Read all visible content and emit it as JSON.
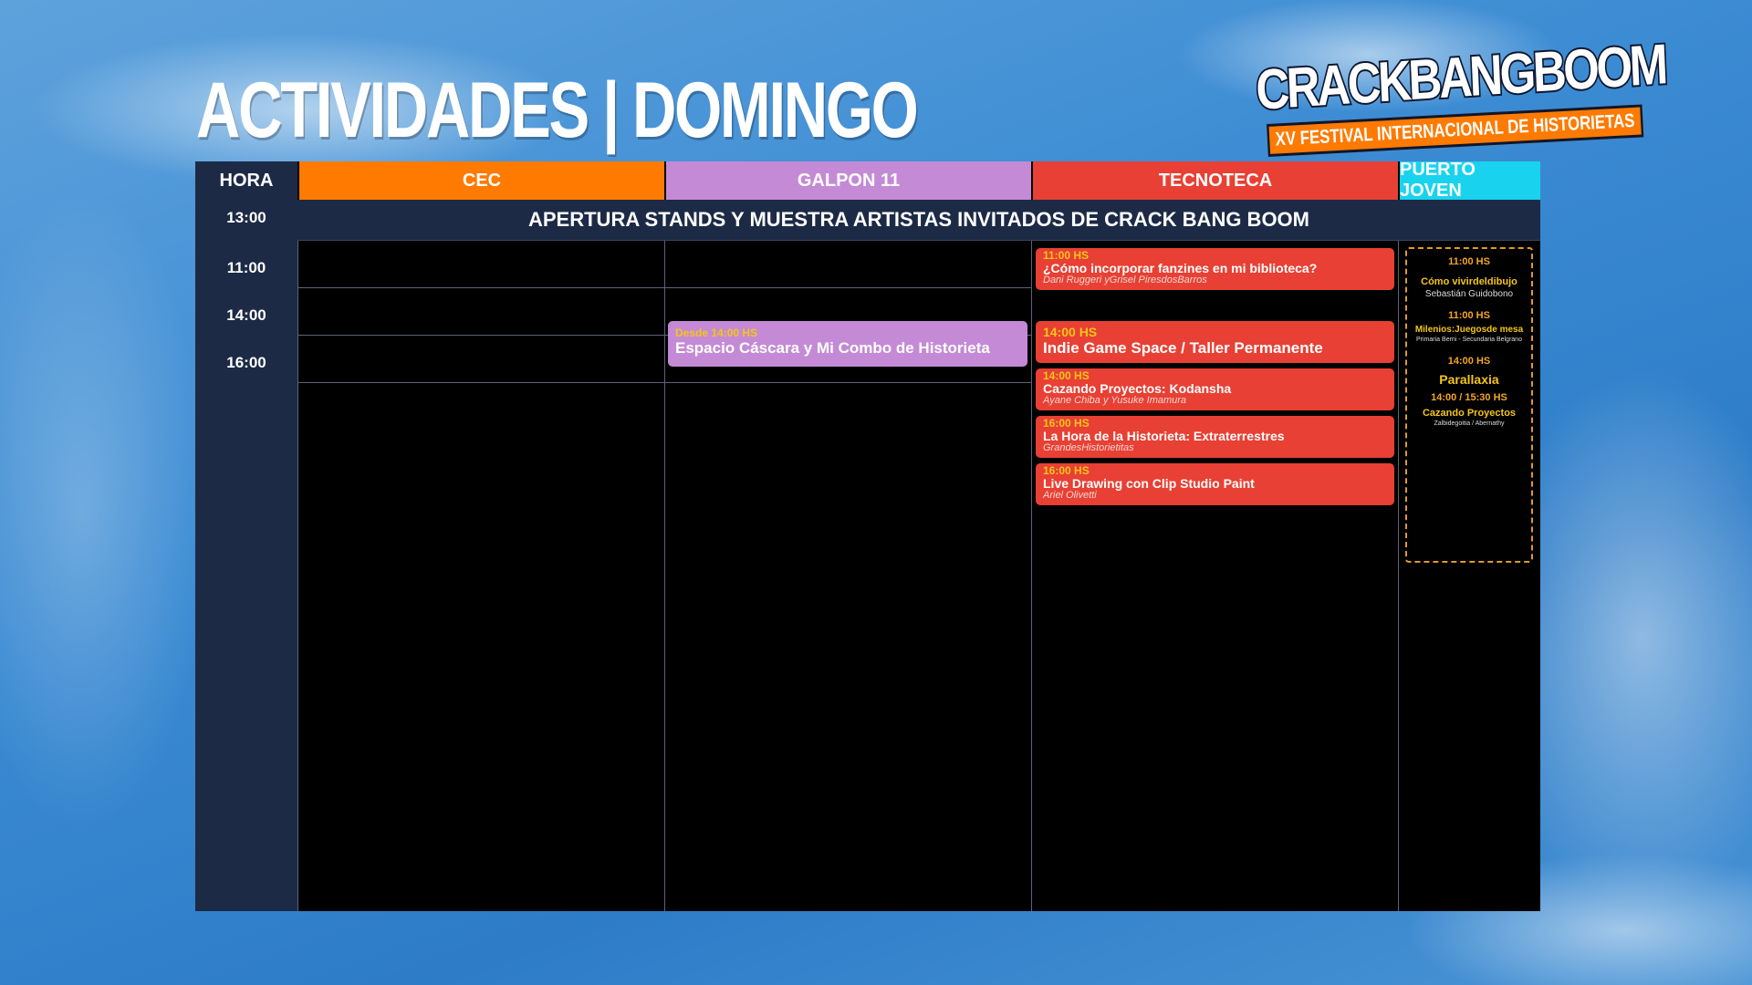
{
  "title": "ACTIVIDADES | DOMINGO",
  "logo": {
    "main": "CRACKBANGBOOM",
    "sub": "XV FESTIVAL INTERNACIONAL DE HISTORIETAS"
  },
  "columns": [
    {
      "label": "HORA",
      "color": "#1c2a45"
    },
    {
      "label": "CEC",
      "color": "#ff7a00"
    },
    {
      "label": "GALPON 11",
      "color": "#c48ad6"
    },
    {
      "label": "TECNOTECA",
      "color": "#e84034"
    },
    {
      "label": "PUERTO JOVEN",
      "color": "#19d3ee"
    }
  ],
  "banner": {
    "time": "13:00",
    "text": "APERTURA STANDS Y MUESTRA ARTISTAS INVITADOS DE CRACK BANG BOOM"
  },
  "times": [
    "11:00",
    "14:00",
    "16:00"
  ],
  "galpon": [
    {
      "time": "Desde 14:00 HS",
      "name": "Espacio Cáscara y Mi Combo de Historieta"
    }
  ],
  "tecnoteca": [
    {
      "time": "11:00 HS",
      "name": "¿Cómo incorporar fanzines en mi biblioteca?",
      "sub": "Dani Ruggeri yGrisel PiresdosBarros"
    },
    {
      "time": "14:00 HS",
      "name": "Indie Game Space / Taller Permanente",
      "sub": ""
    },
    {
      "time": "14:00 HS",
      "name": "Cazando Proyectos: Kodansha",
      "sub": "Ayane Chiba y Yusuke Imamura"
    },
    {
      "time": "16:00 HS",
      "name": "La Hora de la Historieta: Extraterrestres",
      "sub": "GrandesHistorietitas"
    },
    {
      "time": "16:00 HS",
      "name": "Live Drawing con Clip Studio Paint",
      "sub": "Ariel Olivetti"
    }
  ],
  "puerto_joven": [
    {
      "time": "11:00 HS",
      "name": "Cómo vivirdeldibujo",
      "sub": "Sebastián Guidobono"
    },
    {
      "time": "11:00 HS",
      "name": "Milenios:Juegosde mesa",
      "sub": "Primaria Berni - Secundaria Belgrano"
    },
    {
      "time": "14:00 HS",
      "name": "Parallaxia",
      "sub": ""
    },
    {
      "time": "14:00 / 15:30 HS",
      "name": "Cazando Proyectos",
      "sub": "Zalbidegoitia / Abernathy"
    }
  ]
}
